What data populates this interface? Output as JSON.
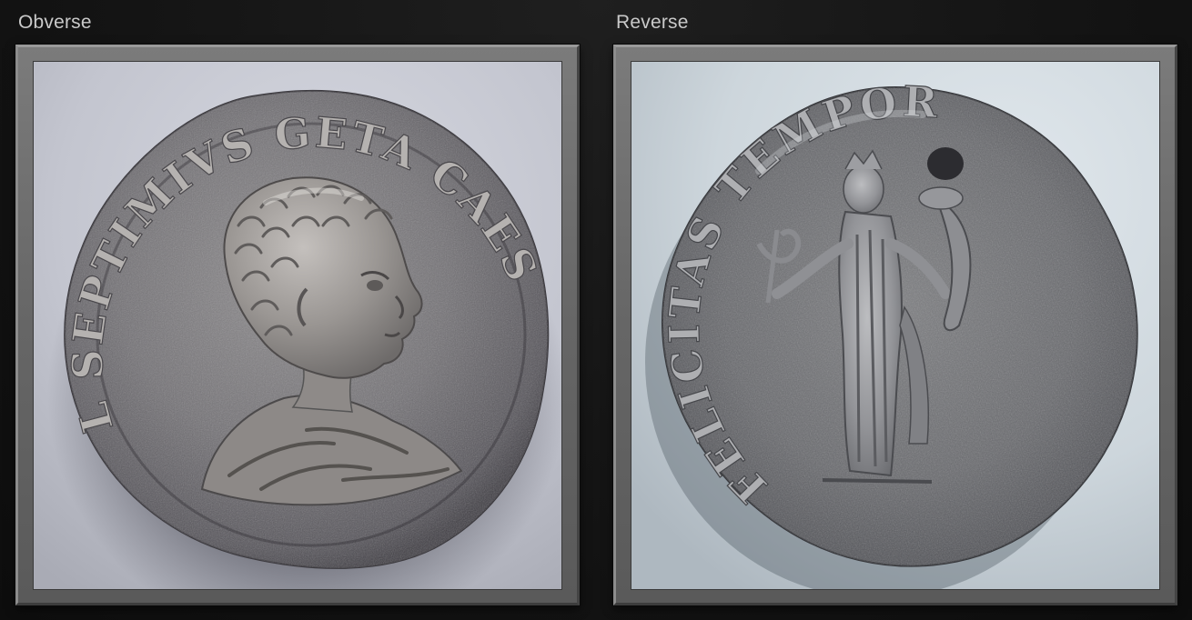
{
  "panels": {
    "obverse": {
      "label": "Obverse",
      "legend": "L SEPTIMIVS GETA CAES"
    },
    "reverse": {
      "label": "Reverse",
      "legend": "FELICITAS TEMPOR"
    }
  },
  "colors": {
    "page_background": "#141414",
    "label_text": "#c9c9c9",
    "frame": "#6b6b6b",
    "obverse_backdrop": "#c6c8d2",
    "reverse_backdrop": "#cfd8de",
    "coin_silver": "#76767a"
  }
}
